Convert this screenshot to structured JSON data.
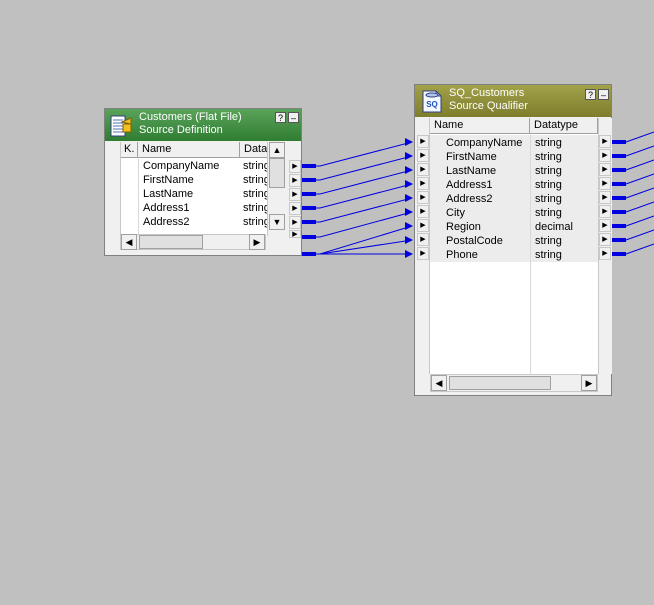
{
  "source_definition": {
    "title_line1": "Customers (Flat File)",
    "title_line2": "Source Definition",
    "help_button": "?",
    "minimize_button": "–",
    "columns": [
      "K.",
      "Name",
      "Datat"
    ],
    "rows": [
      {
        "name": "CompanyName",
        "type": "string"
      },
      {
        "name": "FirstName",
        "type": "string"
      },
      {
        "name": "LastName",
        "type": "string"
      },
      {
        "name": "Address1",
        "type": "string"
      },
      {
        "name": "Address2",
        "type": "string"
      }
    ]
  },
  "source_qualifier": {
    "title_line1": "SQ_Customers",
    "title_line2": "Source Qualifier",
    "icon_text": "SQ",
    "help_button": "?",
    "minimize_button": "–",
    "columns": [
      "Name",
      "Datatype"
    ],
    "rows": [
      {
        "name": "CompanyName",
        "type": "string"
      },
      {
        "name": "FirstName",
        "type": "string"
      },
      {
        "name": "LastName",
        "type": "string"
      },
      {
        "name": "Address1",
        "type": "string"
      },
      {
        "name": "Address2",
        "type": "string"
      },
      {
        "name": "City",
        "type": "string"
      },
      {
        "name": "Region",
        "type": "decimal"
      },
      {
        "name": "PostalCode",
        "type": "string"
      },
      {
        "name": "Phone",
        "type": "string"
      }
    ]
  },
  "colors": {
    "workspace": "#c0c0c0",
    "source_header": "#2f7d32",
    "qualifier_header": "#7d7d2d",
    "link": "#0000e0"
  },
  "icons": {
    "port": "triangle-right",
    "scroll_left": "triangle-left",
    "scroll_right": "triangle-right",
    "scroll_up": "triangle-up",
    "scroll_down": "triangle-down"
  }
}
